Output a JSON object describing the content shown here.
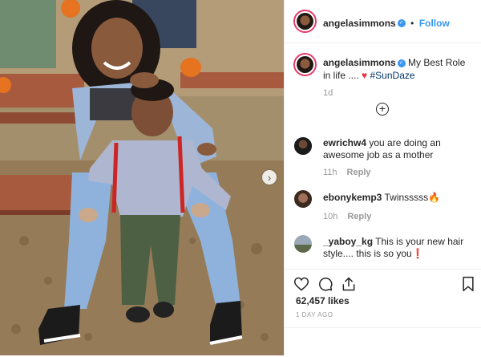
{
  "header": {
    "username": "angelasimmons",
    "verified_symbol": "✓",
    "dot": "•",
    "follow_label": "Follow"
  },
  "caption": {
    "username": "angelasimmons",
    "text": "My Best Role in life ....",
    "heart": "♥",
    "hashtag": "#SunDaze",
    "age": "1d"
  },
  "load_more_symbol": "+",
  "comments": [
    {
      "username": "ewrichw4",
      "text": "you are doing an awesome job as a mother",
      "age": "11h",
      "reply": "Reply"
    },
    {
      "username": "ebonykemp3",
      "text": "Twinsssss🔥",
      "age": "10h",
      "reply": "Reply"
    },
    {
      "username": "_yaboy_kg",
      "text": "This is your new hair style.... this is so you❗",
      "age": "",
      "reply": ""
    }
  ],
  "likes": "62,457 likes",
  "posted_ago": "1 DAY AGO",
  "carousel_next": "›",
  "icons": [
    "heart-icon",
    "comment-icon",
    "share-icon",
    "bookmark-icon",
    "add-comment-icon",
    "chevron-right-icon"
  ],
  "colors": {
    "link": "#3897f0",
    "hashtag": "#003569",
    "story_ring": "#e43b6a",
    "meta": "#999999"
  }
}
